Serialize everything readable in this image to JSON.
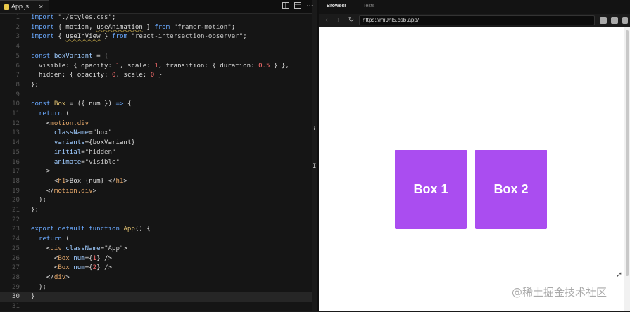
{
  "editor": {
    "tab_label": "App.js",
    "close_glyph": "×",
    "toolbar_icons": [
      "split-editor",
      "preview",
      "more"
    ],
    "line_numbers": [
      "1",
      "2",
      "3",
      "4",
      "5",
      "6",
      "7",
      "8",
      "9",
      "10",
      "11",
      "12",
      "13",
      "14",
      "15",
      "16",
      "17",
      "18",
      "19",
      "20",
      "21",
      "22",
      "23",
      "24",
      "25",
      "26",
      "27",
      "28",
      "29",
      "30",
      "31"
    ],
    "active_line": 30
  },
  "browser": {
    "tabs": [
      "Browser",
      "Tests"
    ],
    "url": "https://mi9hl5.csb.app/",
    "boxes": [
      "Box 1",
      "Box 2"
    ],
    "box_color": "#aa4df0"
  },
  "watermark": "@稀土掘金技术社区"
}
